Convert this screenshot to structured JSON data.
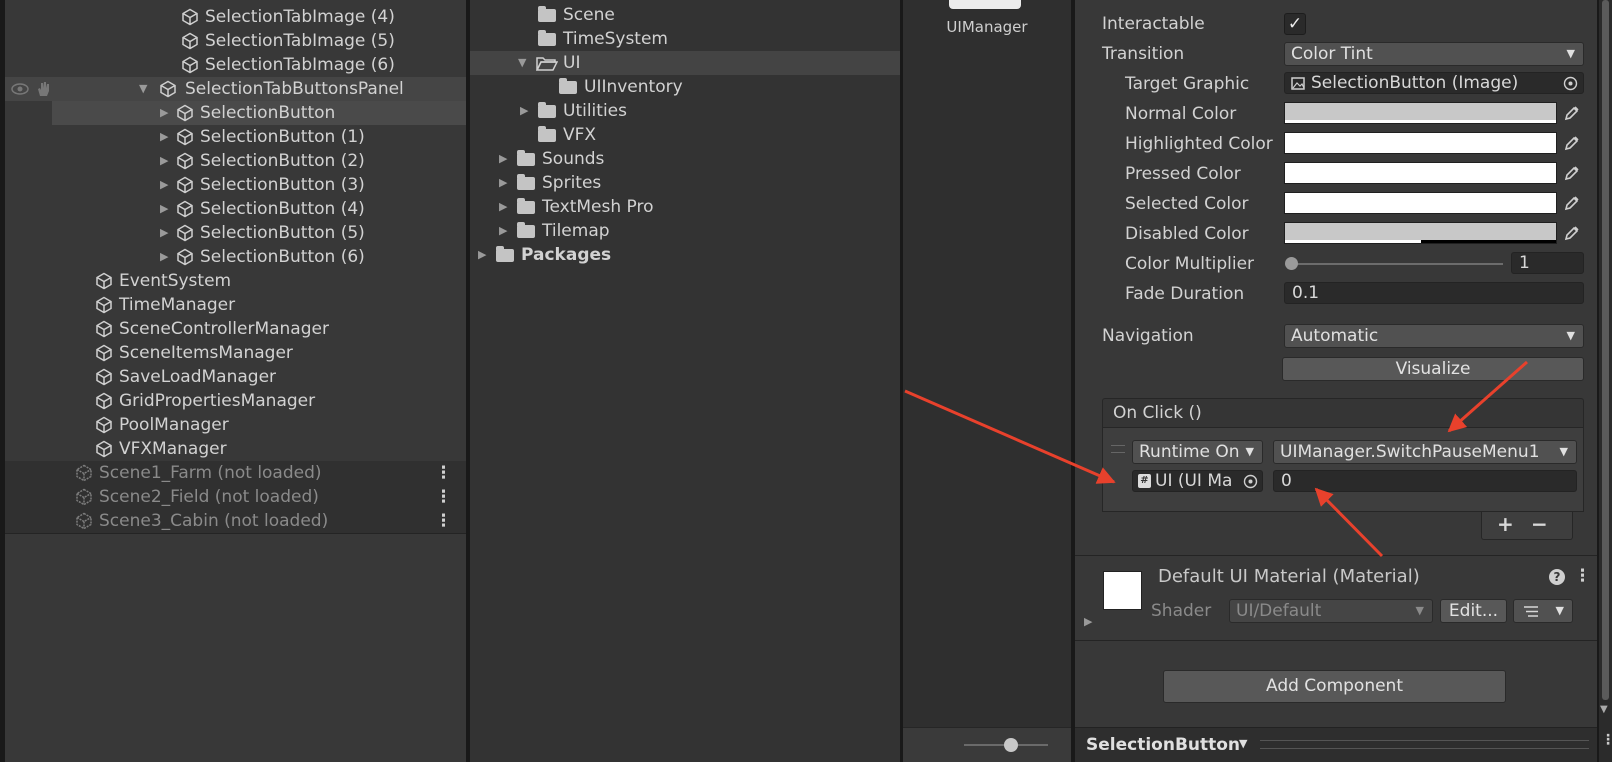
{
  "hierarchy": {
    "top_items": [
      {
        "label": "SelectionTabImage (4)"
      },
      {
        "label": "SelectionTabImage (5)"
      },
      {
        "label": "SelectionTabImage (6)"
      }
    ],
    "panel_item": {
      "label": "SelectionTabButtonsPanel"
    },
    "buttons": [
      {
        "label": "SelectionButton"
      },
      {
        "label": "SelectionButton (1)"
      },
      {
        "label": "SelectionButton (2)"
      },
      {
        "label": "SelectionButton (3)"
      },
      {
        "label": "SelectionButton (4)"
      },
      {
        "label": "SelectionButton (5)"
      },
      {
        "label": "SelectionButton (6)"
      }
    ],
    "managers": [
      {
        "label": "EventSystem"
      },
      {
        "label": "TimeManager"
      },
      {
        "label": "SceneControllerManager"
      },
      {
        "label": "SceneItemsManager"
      },
      {
        "label": "SaveLoadManager"
      },
      {
        "label": "GridPropertiesManager"
      },
      {
        "label": "PoolManager"
      },
      {
        "label": "VFXManager"
      }
    ],
    "scenes": [
      {
        "label": "Scene1_Farm (not loaded)"
      },
      {
        "label": "Scene2_Field (not loaded)"
      },
      {
        "label": "Scene3_Cabin (not loaded)"
      }
    ],
    "kebab": "⋮"
  },
  "project": {
    "items": [
      {
        "label": "Scene"
      },
      {
        "label": "TimeSystem"
      },
      {
        "label": "UI"
      },
      {
        "label": "UIInventory"
      },
      {
        "label": "Utilities"
      },
      {
        "label": "VFX"
      },
      {
        "label": "Sounds"
      },
      {
        "label": "Sprites"
      },
      {
        "label": "TextMesh Pro"
      },
      {
        "label": "Tilemap"
      },
      {
        "label": "Packages"
      }
    ]
  },
  "preview": {
    "label": "UIManager"
  },
  "inspector": {
    "interactable_label": "Interactable",
    "interactable_check": "✓",
    "transition_label": "Transition",
    "transition_value": "Color Tint",
    "target_graphic_label": "Target Graphic",
    "target_graphic_value": "SelectionButton (Image)",
    "normal_color_label": "Normal Color",
    "highlighted_color_label": "Highlighted Color",
    "pressed_color_label": "Pressed Color",
    "selected_color_label": "Selected Color",
    "disabled_color_label": "Disabled Color",
    "color_multiplier_label": "Color Multiplier",
    "color_multiplier_value": "1",
    "fade_duration_label": "Fade Duration",
    "fade_duration_value": "0.1",
    "navigation_label": "Navigation",
    "navigation_value": "Automatic",
    "visualize_label": "Visualize",
    "onclick_title": "On Click ()",
    "runtime_value": "Runtime On",
    "function_value": "UIManager.SwitchPauseMenu1",
    "object_value": "UI (UI Ma",
    "argument_value": "0",
    "add_label": "+",
    "remove_label": "−",
    "material_title": "Default UI Material (Material)",
    "shader_label": "Shader",
    "shader_value": "UI/Default",
    "edit_label": "Edit...",
    "add_component_label": "Add Component",
    "help_glyph": "?",
    "kebab": "⋮",
    "footer_label": "SelectionButton"
  },
  "colors": {
    "arrow": "#e8412c",
    "panel": "#383838",
    "field": "#2a2a2a"
  }
}
